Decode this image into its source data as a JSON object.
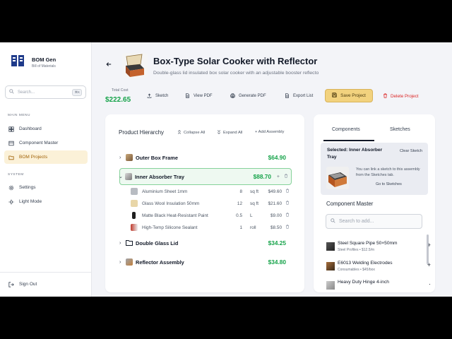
{
  "app": {
    "title": "BOM Gen",
    "subtitle": "Bill of Materials"
  },
  "sidebar": {
    "search_placeholder": "Search...",
    "search_shortcut": "⌘K",
    "main_menu_label": "MAIN MENU",
    "items": [
      {
        "label": "Dashboard",
        "icon": "dashboard-icon"
      },
      {
        "label": "Component Master",
        "icon": "box-icon"
      },
      {
        "label": "BOM Projects",
        "icon": "folder-icon",
        "active": true
      }
    ],
    "system_label": "SYSTEM",
    "system_items": [
      {
        "label": "Settings",
        "icon": "gear-icon"
      },
      {
        "label": "Light Mode",
        "icon": "sun-icon"
      }
    ],
    "signout_label": "Sign Out"
  },
  "project": {
    "title": "Box-Type Solar Cooker with Reflector",
    "description": "Double-glass lid insulated box solar cooker with an adjustable booster reflecto",
    "total_cost_label": "Total Cost",
    "total_cost": "$222.65"
  },
  "toolbar": {
    "sketch": "Sketch",
    "view_pdf": "View PDF",
    "generate_pdf": "Generate PDF",
    "export_list": "Export List",
    "save_project": "Save Project",
    "delete_project": "Delete Project"
  },
  "hierarchy": {
    "title": "Product Hierarchy",
    "collapse_all": "Collapse All",
    "expand_all": "Expand All",
    "add_assembly": "+ Add Assembly",
    "assemblies": [
      {
        "name": "Outer Box Frame",
        "price": "$64.90",
        "expanded": false
      },
      {
        "name": "Inner Absorber Tray",
        "price": "$88.70",
        "expanded": true,
        "selected": true,
        "parts": [
          {
            "name": "Aluminium Sheet 1mm",
            "qty": "8",
            "unit": "sq ft",
            "cost": "$49.60"
          },
          {
            "name": "Glass Wool Insulation 50mm",
            "qty": "12",
            "unit": "sq ft",
            "cost": "$21.60"
          },
          {
            "name": "Matte Black Heat-Resistant Paint",
            "qty": "0.5",
            "unit": "L",
            "cost": "$9.00"
          },
          {
            "name": "High-Temp Silicone Sealant",
            "qty": "1",
            "unit": "roll",
            "cost": "$8.50"
          }
        ]
      },
      {
        "name": "Double Glass Lid",
        "price": "$34.25",
        "expanded": false
      },
      {
        "name": "Reflector Assembly",
        "price": "$34.80",
        "expanded": false
      }
    ]
  },
  "side_panel": {
    "tabs": [
      "Components",
      "Sketches"
    ],
    "selected_label": "Selected: Inner Absorber Tray",
    "clear_sketch": "Clear Sketch",
    "link_message": "You can link a sketch to this assembly from the Sketches tab.",
    "go_to_sketches": "Go to Sketches",
    "component_master_title": "Component Master",
    "search_placeholder": "Search to add...",
    "components": [
      {
        "name": "Steel Square Pipe 50×50mm",
        "meta": "Steel Profiles • $12.5/m"
      },
      {
        "name": "E6013 Welding Electrodes",
        "meta": "Consumables • $45/box"
      },
      {
        "name": "Heavy Duty Hinge 4-inch",
        "meta": ""
      }
    ]
  },
  "colors": {
    "accent": "#f2d27e",
    "price_green": "#16a34a",
    "danger": "#dc2626",
    "active_nav_bg": "#fbf1d8"
  }
}
